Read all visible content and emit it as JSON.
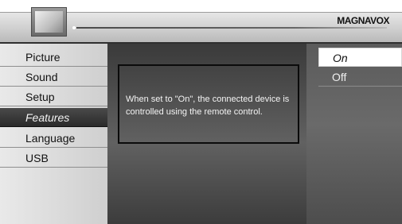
{
  "header": {
    "brand": "MAGNAVOX",
    "tv_icon": "tv-icon"
  },
  "menu": {
    "items": [
      {
        "label": "Picture",
        "selected": false
      },
      {
        "label": "Sound",
        "selected": false
      },
      {
        "label": "Setup",
        "selected": false
      },
      {
        "label": "Features",
        "selected": true
      },
      {
        "label": "Language",
        "selected": false
      },
      {
        "label": "USB",
        "selected": false
      }
    ]
  },
  "info": {
    "text": "When set to \"On\", the connected device is controlled using the remote control."
  },
  "options": [
    {
      "label": "On",
      "selected": true
    },
    {
      "label": "Off",
      "selected": false
    }
  ],
  "colors": {
    "accent": "#2f2f2f"
  }
}
